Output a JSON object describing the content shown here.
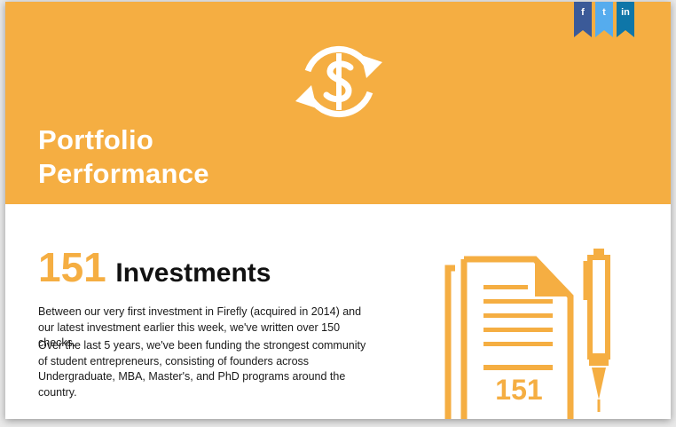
{
  "hero": {
    "icon": "dollar-cycle-icon",
    "title_line1": "Portfolio",
    "title_line2": "Performance",
    "background": "#f5ae42"
  },
  "share": [
    {
      "name": "facebook-icon",
      "label": "f",
      "color": "#3b5a98"
    },
    {
      "name": "twitter-icon",
      "label": "t",
      "color": "#55acee"
    },
    {
      "name": "linkedin-icon",
      "label": "in",
      "color": "#0e76a8"
    }
  ],
  "investments": {
    "count": "151",
    "title": "Investments",
    "paragraph1": "Between our very first investment in Firefly (acquired in 2014) and our latest investment earlier this week, we've written over 150 checks.",
    "paragraph2": "Over the last 5 years, we've been funding the strongest community of student entrepreneurs, consisting of founders across Undergraduate, MBA, Master's, and PhD programs around the country.",
    "illustration": {
      "icon": "document-pen-icon",
      "doc_number": "151",
      "accent": "#f5ae42"
    }
  }
}
